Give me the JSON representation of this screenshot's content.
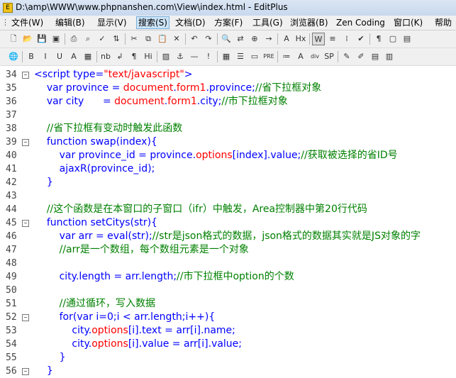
{
  "window": {
    "title": "D:\\amp\\WWW\\www.phpnanshen.com\\View\\index.html - EditPlus",
    "app_icon": "editplus-icon"
  },
  "menu": [
    {
      "label": "文件(W)",
      "active": false
    },
    {
      "label": "编辑(B)",
      "active": false
    },
    {
      "label": "显示(V)",
      "active": false
    },
    {
      "label": "搜索(S)",
      "active": true
    },
    {
      "label": "文档(D)",
      "active": false
    },
    {
      "label": "方案(F)",
      "active": false
    },
    {
      "label": "工具(G)",
      "active": false
    },
    {
      "label": "浏览器(B)",
      "active": false
    },
    {
      "label": "Zen Coding",
      "active": false
    },
    {
      "label": "窗口(K)",
      "active": false
    },
    {
      "label": "帮助",
      "active": false
    }
  ],
  "toolbar1": [
    {
      "name": "new-file-icon",
      "glyph": "🗋"
    },
    {
      "name": "open-file-icon",
      "glyph": "📂"
    },
    {
      "name": "save-icon",
      "glyph": "💾"
    },
    {
      "name": "save-all-icon",
      "glyph": "▣"
    },
    {
      "name": "print-icon",
      "glyph": "⎙"
    },
    {
      "name": "print-preview-icon",
      "glyph": "⌕"
    },
    {
      "name": "spellcheck-icon",
      "glyph": "✓"
    },
    {
      "name": "ftp-icon",
      "glyph": "⇅"
    },
    {
      "name": "cut-icon",
      "glyph": "✂"
    },
    {
      "name": "copy-icon",
      "glyph": "⧉"
    },
    {
      "name": "paste-icon",
      "glyph": "📋"
    },
    {
      "name": "delete-icon",
      "glyph": "✕"
    },
    {
      "name": "undo-icon",
      "glyph": "↶"
    },
    {
      "name": "redo-icon",
      "glyph": "↷"
    },
    {
      "name": "find-icon",
      "glyph": "🔍"
    },
    {
      "name": "replace-icon",
      "glyph": "⇄"
    },
    {
      "name": "find-in-files-icon",
      "glyph": "⊕"
    },
    {
      "name": "goto-icon",
      "glyph": "→"
    },
    {
      "name": "font-icon",
      "glyph": "A"
    },
    {
      "name": "hex-icon",
      "glyph": "Hx"
    },
    {
      "name": "word-wrap-icon",
      "glyph": "W"
    },
    {
      "name": "line-numbers-icon",
      "glyph": "≡"
    },
    {
      "name": "column-select-icon",
      "glyph": "⁞"
    },
    {
      "name": "checkmark-icon",
      "glyph": "✔"
    },
    {
      "name": "view-whitespace-icon",
      "glyph": "¶"
    },
    {
      "name": "fullscreen-icon",
      "glyph": "▢"
    },
    {
      "name": "output-window-icon",
      "glyph": "▤"
    }
  ],
  "toolbar2": [
    {
      "name": "browser-preview-icon",
      "glyph": "🌐"
    },
    {
      "name": "bold-icon",
      "glyph": "B"
    },
    {
      "name": "italic-icon",
      "glyph": "I"
    },
    {
      "name": "underline-icon",
      "glyph": "U"
    },
    {
      "name": "font-color-icon",
      "glyph": "A"
    },
    {
      "name": "color-picker-icon",
      "glyph": "▦"
    },
    {
      "name": "nbsp-icon",
      "glyph": "nb"
    },
    {
      "name": "line-break-icon",
      "glyph": "↲"
    },
    {
      "name": "paragraph-icon",
      "glyph": "¶"
    },
    {
      "name": "heading-icon",
      "glyph": "Hi"
    },
    {
      "name": "image-icon",
      "glyph": "▨"
    },
    {
      "name": "anchor-icon",
      "glyph": "⚓"
    },
    {
      "name": "hr-icon",
      "glyph": "—"
    },
    {
      "name": "comment-icon",
      "glyph": "!"
    },
    {
      "name": "table-icon",
      "glyph": "▦"
    },
    {
      "name": "form-icon",
      "glyph": "☰"
    },
    {
      "name": "input-field-icon",
      "glyph": "▭"
    },
    {
      "name": "pre-icon",
      "glyph": "PRE"
    },
    {
      "name": "list-icon",
      "glyph": "≔"
    },
    {
      "name": "text-style-icon",
      "glyph": "A"
    },
    {
      "name": "div-icon",
      "glyph": "div"
    },
    {
      "name": "span-icon",
      "glyph": "SP"
    },
    {
      "name": "html-toolbar-icon",
      "glyph": "✎"
    },
    {
      "name": "edit-tag-icon",
      "glyph": "✐"
    },
    {
      "name": "clip-icon",
      "glyph": "▤"
    },
    {
      "name": "more-icon",
      "glyph": "▥"
    }
  ],
  "code_lines": [
    {
      "num": "34",
      "fold": "⊟",
      "indent": "",
      "tokens": [
        {
          "t": "tg",
          "v": "<script type="
        },
        {
          "t": "st",
          "v": "\"text/javascript\""
        },
        {
          "t": "tg",
          "v": ">"
        }
      ]
    },
    {
      "num": "35",
      "fold": "",
      "indent": "    ",
      "tokens": [
        {
          "t": "kw",
          "v": "var"
        },
        {
          "t": "kw",
          "v": " province = "
        },
        {
          "t": "st",
          "v": "document"
        },
        {
          "t": "kw",
          "v": "."
        },
        {
          "t": "st",
          "v": "form1"
        },
        {
          "t": "kw",
          "v": ".province;"
        },
        {
          "t": "cm",
          "v": "//省下拉框对象"
        }
      ]
    },
    {
      "num": "36",
      "fold": "",
      "indent": "    ",
      "tokens": [
        {
          "t": "kw",
          "v": "var"
        },
        {
          "t": "kw",
          "v": " city      = "
        },
        {
          "t": "st",
          "v": "document"
        },
        {
          "t": "kw",
          "v": "."
        },
        {
          "t": "st",
          "v": "form1"
        },
        {
          "t": "kw",
          "v": ".city;"
        },
        {
          "t": "cm",
          "v": "//市下拉框对象"
        }
      ]
    },
    {
      "num": "37",
      "fold": "",
      "indent": "",
      "tokens": []
    },
    {
      "num": "38",
      "fold": "",
      "indent": "    ",
      "tokens": [
        {
          "t": "cm",
          "v": "//省下拉框有变动时触发此函数"
        }
      ]
    },
    {
      "num": "39",
      "fold": "⊟",
      "indent": "    ",
      "tokens": [
        {
          "t": "kw",
          "v": "function"
        },
        {
          "t": "kw",
          "v": " swap(index){"
        }
      ]
    },
    {
      "num": "40",
      "fold": "",
      "indent": "        ",
      "tokens": [
        {
          "t": "kw",
          "v": "var"
        },
        {
          "t": "kw",
          "v": " province_id = province."
        },
        {
          "t": "st",
          "v": "options"
        },
        {
          "t": "kw",
          "v": "[index].value;"
        },
        {
          "t": "cm",
          "v": "//获取被选择的省ID号"
        }
      ]
    },
    {
      "num": "41",
      "fold": "",
      "indent": "        ",
      "tokens": [
        {
          "t": "kw",
          "v": "ajaxR(province_id);"
        }
      ]
    },
    {
      "num": "42",
      "fold": "",
      "indent": "    ",
      "tokens": [
        {
          "t": "kw",
          "v": "}"
        }
      ]
    },
    {
      "num": "43",
      "fold": "",
      "indent": "",
      "tokens": []
    },
    {
      "num": "44",
      "fold": "",
      "indent": "    ",
      "tokens": [
        {
          "t": "cm",
          "v": "//这个函数是在本窗口的子窗口（ifr）中触发，Area控制器中第20行代码"
        }
      ]
    },
    {
      "num": "45",
      "fold": "⊟",
      "indent": "    ",
      "tokens": [
        {
          "t": "kw",
          "v": "function"
        },
        {
          "t": "kw",
          "v": " setCitys(str){"
        }
      ]
    },
    {
      "num": "46",
      "fold": "",
      "indent": "        ",
      "tokens": [
        {
          "t": "kw",
          "v": "var"
        },
        {
          "t": "kw",
          "v": " arr = eval(str);"
        },
        {
          "t": "cm",
          "v": "//str是json格式的数据，json格式的数据其实就是JS对象的字"
        }
      ]
    },
    {
      "num": "47",
      "fold": "",
      "indent": "        ",
      "tokens": [
        {
          "t": "cm",
          "v": "//arr是一个数组，每个数组元素是一个对象"
        }
      ]
    },
    {
      "num": "48",
      "fold": "",
      "indent": "",
      "tokens": []
    },
    {
      "num": "49",
      "fold": "",
      "indent": "        ",
      "tokens": [
        {
          "t": "kw",
          "v": "city.length = arr.length;"
        },
        {
          "t": "cm",
          "v": "//市下拉框中option的个数"
        }
      ]
    },
    {
      "num": "50",
      "fold": "",
      "indent": "",
      "tokens": []
    },
    {
      "num": "51",
      "fold": "",
      "indent": "        ",
      "tokens": [
        {
          "t": "cm",
          "v": "//通过循环，写入数据"
        }
      ]
    },
    {
      "num": "52",
      "fold": "⊟",
      "indent": "        ",
      "tokens": [
        {
          "t": "kw",
          "v": "for"
        },
        {
          "t": "kw",
          "v": "("
        },
        {
          "t": "kw",
          "v": "var"
        },
        {
          "t": "kw",
          "v": " i=0;i < arr.length;i++){"
        }
      ]
    },
    {
      "num": "53",
      "fold": "",
      "indent": "            ",
      "tokens": [
        {
          "t": "kw",
          "v": "city."
        },
        {
          "t": "st",
          "v": "options"
        },
        {
          "t": "kw",
          "v": "[i].text = arr[i].name;"
        }
      ]
    },
    {
      "num": "54",
      "fold": "",
      "indent": "            ",
      "tokens": [
        {
          "t": "kw",
          "v": "city."
        },
        {
          "t": "st",
          "v": "options"
        },
        {
          "t": "kw",
          "v": "[i].value = arr[i].value;"
        }
      ]
    },
    {
      "num": "55",
      "fold": "",
      "indent": "        ",
      "tokens": [
        {
          "t": "kw",
          "v": "}"
        }
      ]
    },
    {
      "num": "56",
      "fold": "⊟",
      "indent": "    ",
      "tokens": [
        {
          "t": "kw",
          "v": "}"
        }
      ]
    }
  ]
}
